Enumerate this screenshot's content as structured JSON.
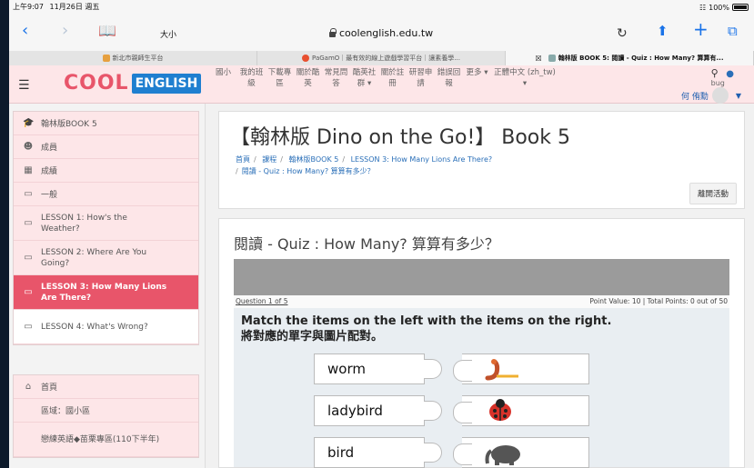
{
  "status": {
    "time": "上午9:07",
    "date": "11月26日 週五",
    "battery": "100%"
  },
  "browser": {
    "text_size": "大小",
    "url": "coolenglish.edu.tw",
    "tabs": [
      {
        "label": "新北市親師生平台",
        "color": "#e6a040"
      },
      {
        "label": "PaGamO｜最有效的線上遊戲學習平台｜讓素養學...",
        "color": "#e85030"
      },
      {
        "label": "翰林版 BOOK 5: 閱讀 - Quiz : How Many? 算算有...",
        "color": "#8aa"
      }
    ]
  },
  "site": {
    "logo_cool": "COOL",
    "logo_english": "ENGLISH",
    "menu": [
      "國小",
      "我的班級",
      "下載專區",
      "關於酷英",
      "常見問答",
      "酷英社群 ▾",
      "關於註冊",
      "研習申請",
      "錯誤回報",
      "更多 ▾",
      "正體中文 (zh_tw) ▾"
    ],
    "bug_label": "bug",
    "user_name": "何 侑勳"
  },
  "sidebar": {
    "course": "翰林版BOOK 5",
    "members": "成員",
    "grades": "成績",
    "general": "一般",
    "lessons": [
      "LESSON 1: How's the Weather?",
      "LESSON 2: Where Are You Going?",
      "LESSON 3: How Many Lions Are There?",
      "LESSON 4: What's Wrong?"
    ],
    "home": "首頁",
    "area": "區域：國小區",
    "special": "戀練英語◆苗栗專區(110下半年)"
  },
  "main": {
    "page_title": "【翰林版 Dino on the Go!】 Book 5",
    "breadcrumb": [
      "首頁",
      "課程",
      "翰林版BOOK 5",
      "LESSON 3: How Many Lions Are There?",
      "閱讀 - Quiz : How Many? 算算有多少？"
    ],
    "leave_button": "離開活動",
    "activity_title": "閱讀 - Quiz : How Many? 算算有多少？",
    "quiz": {
      "question": "Question 1 of 5",
      "points": "Point Value: 10  |  Total Points: 0 out of 50",
      "instruction_en": "Match the items on the left with the items on the right.",
      "instruction_zh": "將對應的單字與圖片配對。",
      "items": [
        "worm",
        "ladybird",
        "bird"
      ]
    }
  }
}
